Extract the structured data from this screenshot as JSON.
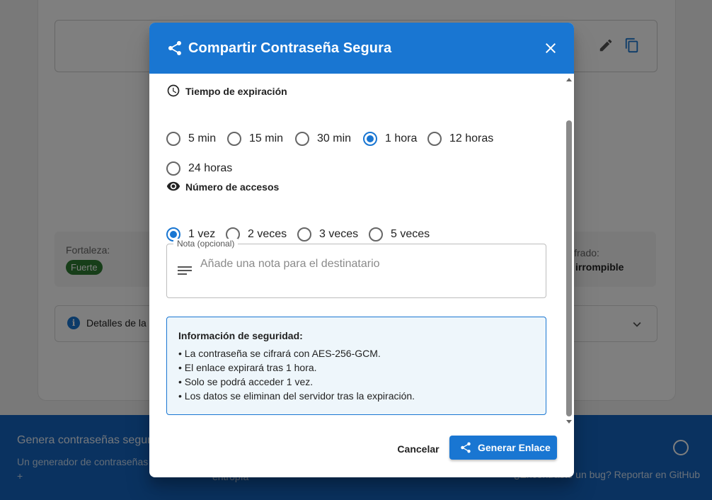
{
  "background": {
    "strength_label": "Fortaleza:",
    "strength_value": "Fuerte",
    "crack_label": "cifrado:",
    "crack_value": "irrompible",
    "details_label": "Detalles de la e",
    "footer": {
      "title": "Genera contraseñas segur",
      "description": "Un generador de contraseñas",
      "plus": "+",
      "middle": "entropía",
      "bug_text": "¿Encontraste un bug? Reportar en GitHub"
    }
  },
  "dialog": {
    "title": "Compartir Contraseña Segura",
    "expiration": {
      "title": "Tiempo de expiración",
      "options": [
        "5 min",
        "15 min",
        "30 min",
        "1 hora",
        "12 horas",
        "24 horas"
      ],
      "selected": "1 hora"
    },
    "access": {
      "title": "Número de accesos",
      "options": [
        "1 vez",
        "2 veces",
        "3 veces",
        "5 veces"
      ],
      "selected": "1 vez"
    },
    "note": {
      "label": "Nota (opcional)",
      "placeholder": "Añade una nota para el destinatario",
      "value": ""
    },
    "security_info": {
      "title": "Información de seguridad:",
      "lines": [
        "• La contraseña se cifrará con AES-256-GCM.",
        "• El enlace expirará tras 1 hora.",
        "• Solo se podrá acceder 1 vez.",
        "• Los datos se eliminan del servidor tras la expiración."
      ]
    },
    "actions": {
      "cancel": "Cancelar",
      "generate": "Generar Enlace"
    }
  },
  "colors": {
    "primary": "#1976d2",
    "footer": "#1565c0",
    "strength": "#2e7d32"
  }
}
